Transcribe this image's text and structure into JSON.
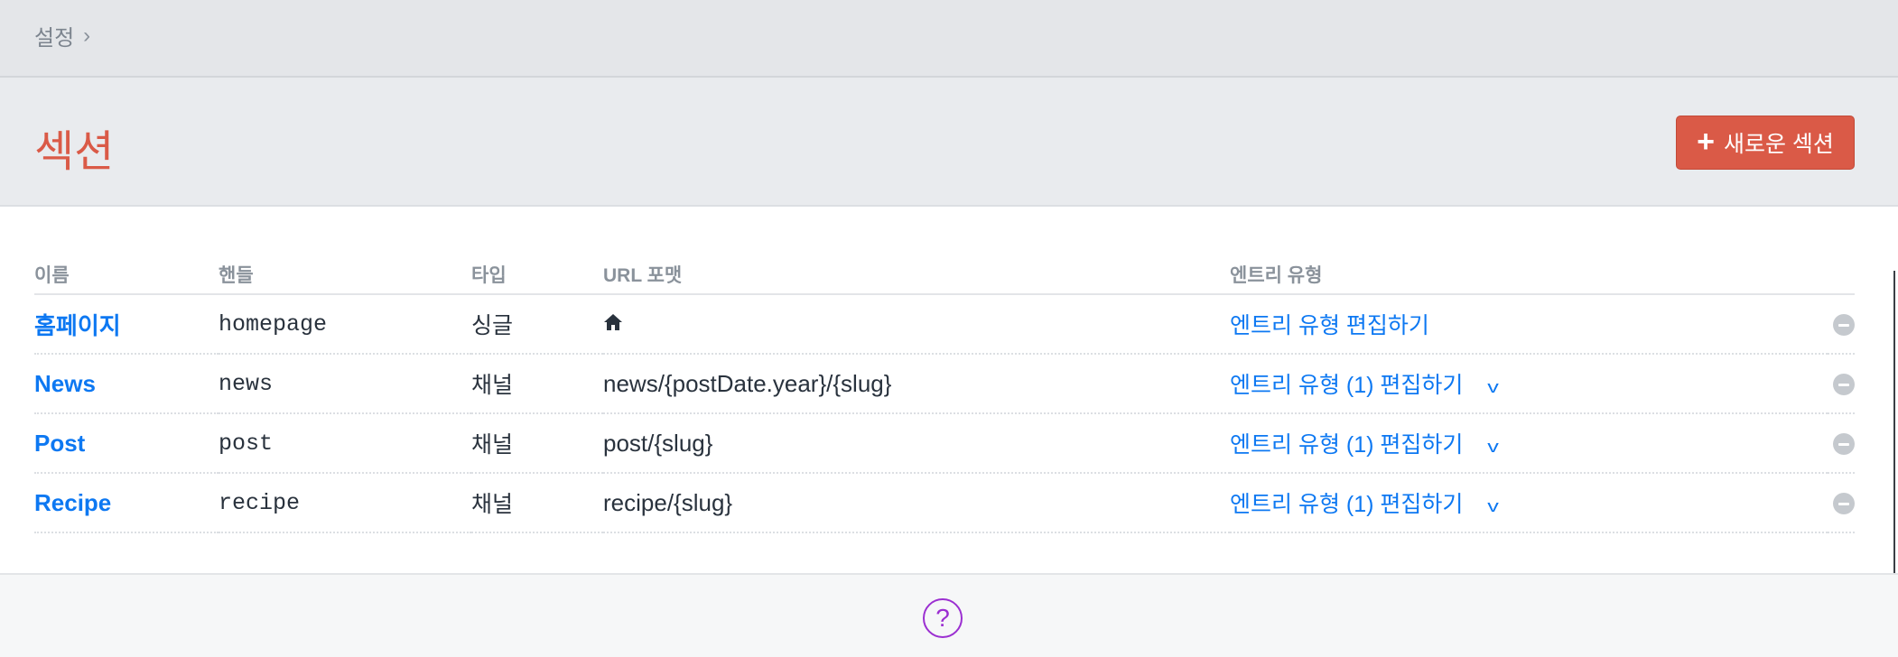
{
  "breadcrumb": {
    "items": [
      {
        "label": "설정"
      }
    ],
    "separator": "›"
  },
  "page": {
    "title": "섹션",
    "new_button": {
      "label": "새로운 섹션",
      "icon": "plus-icon"
    }
  },
  "table": {
    "headers": [
      "이름",
      "핸들",
      "타입",
      "URL 포맷",
      "엔트리 유형"
    ],
    "rows": [
      {
        "name": "홈페이지",
        "handle": "homepage",
        "type": "싱글",
        "url": "",
        "url_icon": "home-icon",
        "entry": "엔트리 유형 편집하기",
        "has_menu": false
      },
      {
        "name": "News",
        "handle": "news",
        "type": "채널",
        "url": "news/{postDate.year}/{slug}",
        "entry": "엔트리 유형 (1) 편집하기",
        "has_menu": true
      },
      {
        "name": "Post",
        "handle": "post",
        "type": "채널",
        "url": "post/{slug}",
        "entry": "엔트리 유형 (1) 편집하기",
        "has_menu": true
      },
      {
        "name": "Recipe",
        "handle": "recipe",
        "type": "채널",
        "url": "recipe/{slug}",
        "entry": "엔트리 유형 (1) 편집하기",
        "has_menu": true
      }
    ]
  },
  "footer": {
    "help": "?"
  },
  "colors": {
    "accent": "#da5a47",
    "link": "#0d78f2",
    "help": "#9b2fd1"
  }
}
